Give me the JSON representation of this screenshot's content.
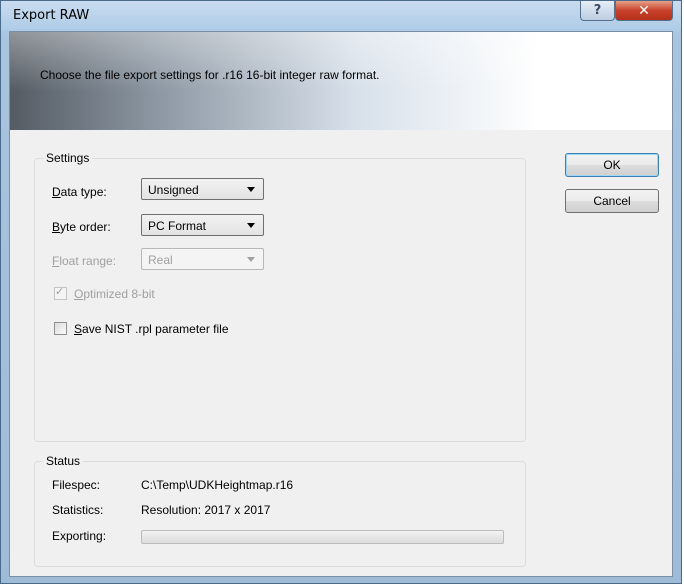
{
  "window": {
    "title": "Export RAW",
    "help_glyph": "?",
    "close_glyph": "✕"
  },
  "header": {
    "description": "Choose the file export settings for .r16 16-bit integer raw format."
  },
  "settings": {
    "group_title": "Settings",
    "data_type": {
      "label_ul": "D",
      "label_rest": "ata type:",
      "value": "Unsigned"
    },
    "byte_order": {
      "label_ul": "B",
      "label_rest": "yte order:",
      "value": "PC Format"
    },
    "float_range": {
      "label_ul": "F",
      "label_rest": "loat range:",
      "value": "Real",
      "disabled": true
    },
    "optimized": {
      "label_ul": "O",
      "label_rest": "ptimized 8-bit",
      "checked": true,
      "disabled": true
    },
    "save_nist": {
      "label_ul": "S",
      "label_rest": "ave NIST .rpl parameter file",
      "checked": false
    }
  },
  "status": {
    "group_title": "Status",
    "filespec_label": "Filespec:",
    "filespec_value": "C:\\Temp\\UDKHeightmap.r16",
    "statistics_label": "Statistics:",
    "statistics_value": "Resolution: 2017 x 2017",
    "exporting_label": "Exporting:",
    "progress": 0
  },
  "buttons": {
    "ok": "OK",
    "cancel": "Cancel"
  },
  "icons": {
    "help": "help-icon",
    "close": "close-icon",
    "dropdown": "chevron-down-icon",
    "check": "checkmark-icon"
  }
}
